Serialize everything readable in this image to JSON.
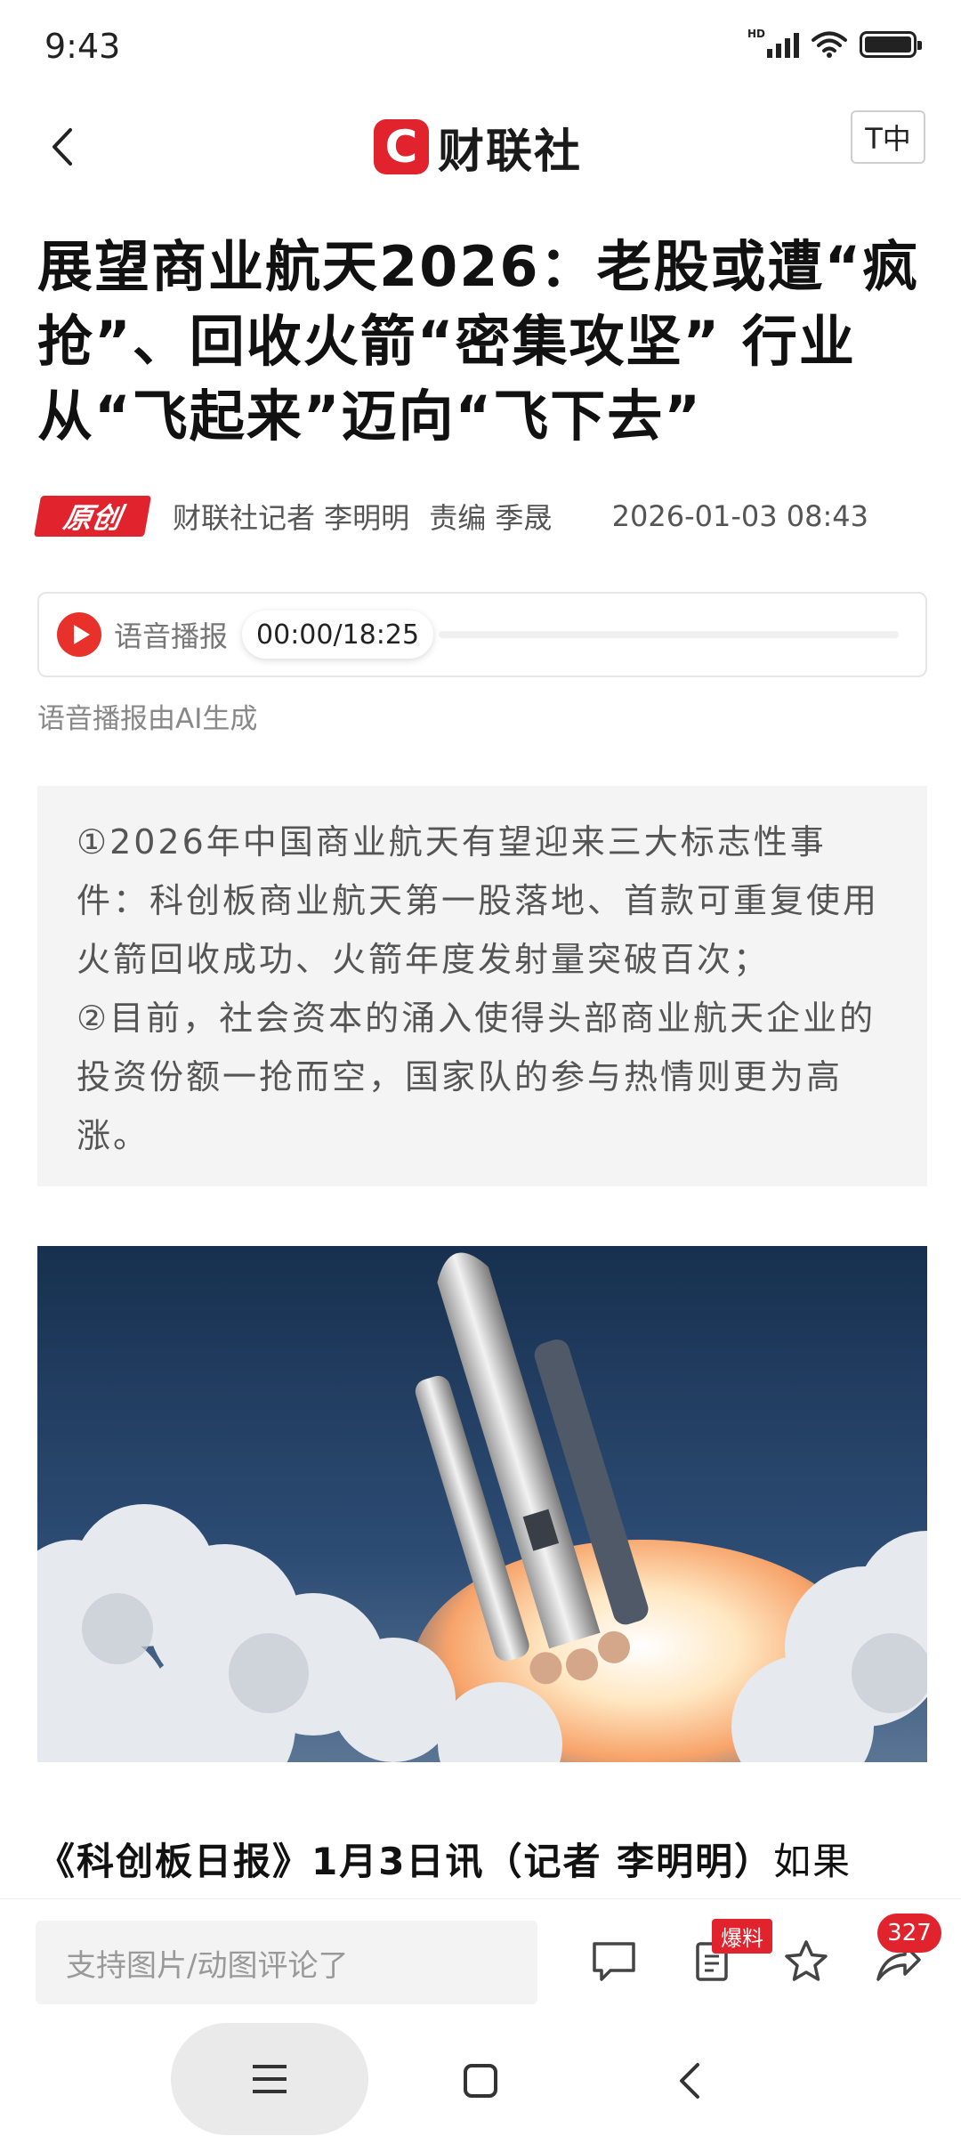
{
  "status_bar": {
    "time": "9:43",
    "network_label": "HD"
  },
  "header": {
    "logo_mark": "C",
    "logo_text": "财联社",
    "font_size_button": "T中"
  },
  "article": {
    "title": "展望商业航天2026：老股或遭“疯抢”、回收火箭“密集攻坚” 行业从“飞起来”迈向“飞下去”",
    "badge": "原创",
    "author": "财联社记者 李明明",
    "editor": "责编 季晟",
    "publish_time": "2026-01-03 08:43",
    "audio": {
      "label": "语音播报",
      "time": "00:00/18:25",
      "progress": 0,
      "note": "语音播报由AI生成"
    },
    "summary": [
      "①2026年中国商业航天有望迎来三大标志性事件：科创板商业航天第一股落地、首款可重复使用火箭回收成功、火箭年度发射量突破百次；",
      "②目前，社会资本的涌入使得头部商业航天企业的投资份额一抢而空，国家队的参与热情则更为高涨。"
    ],
    "lead_bold": "《科创板日报》1月3日讯（记者 李明明）",
    "lead_rest": "如果"
  },
  "action_bar": {
    "comment_placeholder": "支持图片/动图评论了",
    "tip_badge": "爆料",
    "share_count": "327"
  },
  "colors": {
    "brand_red": "#e0232c",
    "text_dark": "#111111",
    "text_meta": "#555555",
    "summary_bg": "#f4f4f4"
  },
  "icons": {
    "back": "chevron-left-icon",
    "play": "play-icon",
    "comment": "comment-icon",
    "tip": "document-icon",
    "favorite": "star-icon",
    "share": "share-icon",
    "nav_menu": "menu-icon",
    "nav_home": "square-home-icon",
    "nav_back": "back-icon"
  }
}
